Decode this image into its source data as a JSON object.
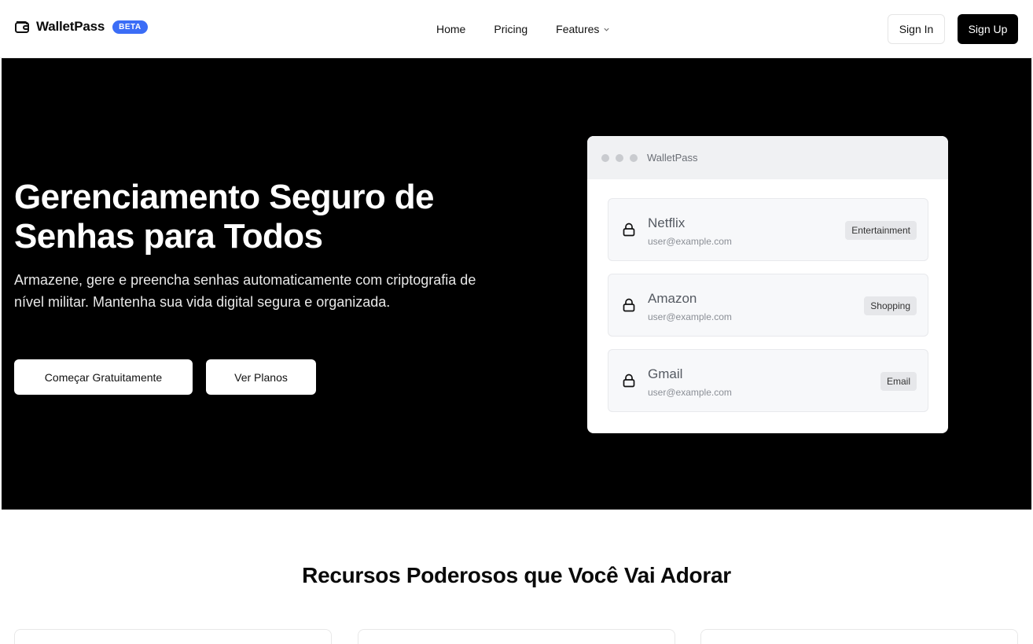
{
  "header": {
    "brand": "WalletPass",
    "badge": "BETA",
    "nav": [
      "Home",
      "Pricing",
      "Features"
    ],
    "sign_in": "Sign In",
    "sign_up": "Sign Up"
  },
  "hero": {
    "title": "Gerenciamento Seguro de Senhas para Todos",
    "subtitle": "Armazene, gere e preencha senhas automaticamente com criptografia de nível militar. Mantenha sua vida digital segura e organizada.",
    "primary_button": "Começar Gratuitamente",
    "secondary_button": "Ver Planos"
  },
  "mock": {
    "window_title": "WalletPass",
    "entries": [
      {
        "name": "Netflix",
        "email": "user@example.com",
        "tag": "Entertainment"
      },
      {
        "name": "Amazon",
        "email": "user@example.com",
        "tag": "Shopping"
      },
      {
        "name": "Gmail",
        "email": "user@example.com",
        "tag": "Email"
      }
    ]
  },
  "features": {
    "title": "Recursos Poderosos que Você Vai Adorar"
  },
  "colors": {
    "badge": "#3b6df6",
    "hero_bg": "#000000",
    "primary_dark": "#000000"
  },
  "icons": [
    "wallet-icon",
    "chevron-down-icon",
    "lock-icon"
  ]
}
